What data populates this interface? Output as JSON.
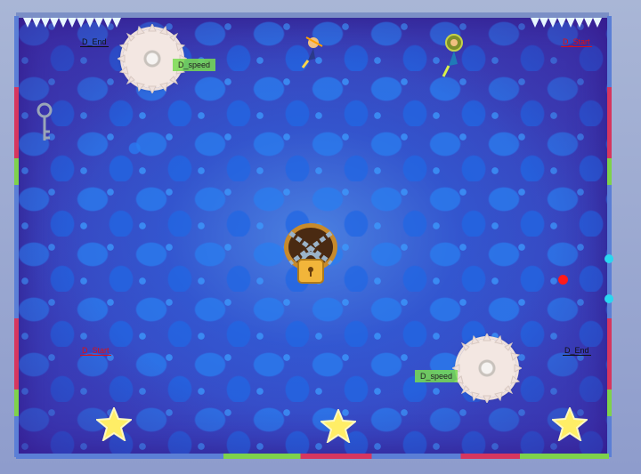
{
  "labels": {
    "end_top_left": "D_End",
    "start_top_right": "D_Start",
    "start_bottom_left": "D_Start",
    "end_bottom_right": "D_End",
    "speed_top": "D_speed",
    "speed_bottom": "D_speed"
  },
  "colors": {
    "label_end": "#111111",
    "label_start": "#e01010",
    "speed_bg": "#78dc50",
    "target_dot": "#ff1a1a",
    "wall_node": "#29d7f0",
    "star": "#ffee66"
  },
  "icons": [
    "saw-blade-icon",
    "key-icon",
    "padlock-icon",
    "star-icon",
    "character-icon"
  ]
}
